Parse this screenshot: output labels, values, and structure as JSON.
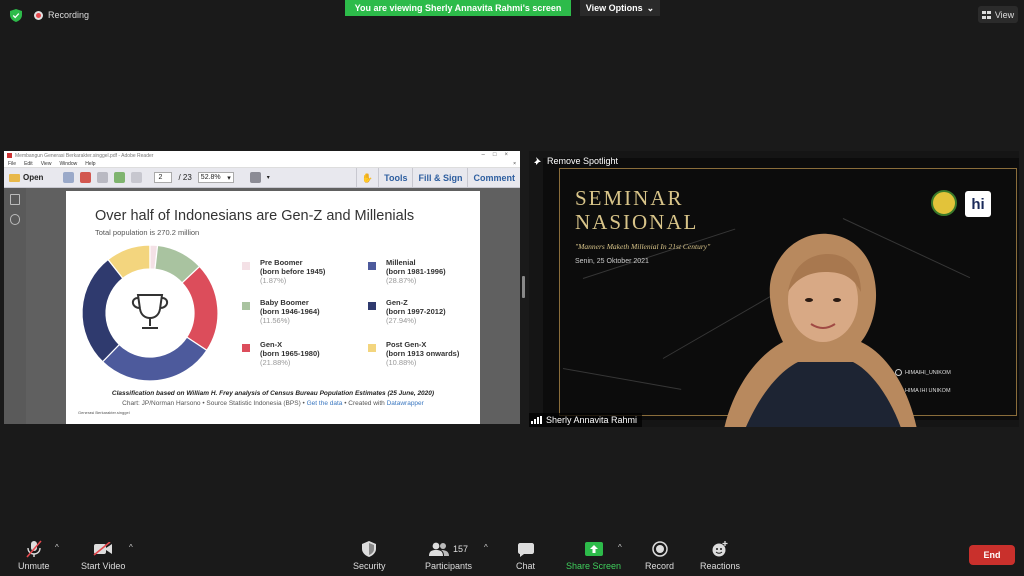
{
  "top": {
    "recording_label": "Recording",
    "banner_text": "You are viewing Sherly Annavita Rahmi's screen",
    "view_options_label": "View Options",
    "view_label": "View"
  },
  "reader": {
    "window_title": "Membangun Generasi Berkarakter.singgel.pdf - Adobe Reader",
    "menus": [
      "File",
      "Edit",
      "View",
      "Window",
      "Help"
    ],
    "open_label": "Open",
    "page_current": "2",
    "page_total": "/ 23",
    "zoom": "52.8%",
    "tools_label": "Tools",
    "fillsign_label": "Fill & Sign",
    "comment_label": "Comment"
  },
  "slide": {
    "title": "Over half of Indonesians are Gen-Z and Millenials",
    "subtitle": "Total population is 270.2 million",
    "legend": [
      {
        "name": "Pre Boomer",
        "years": "(born before 1945)",
        "pct": "(1.87%)",
        "value": 1.87,
        "color": "#f4e1e6"
      },
      {
        "name": "Baby Boomer",
        "years": "(born 1946-1964)",
        "pct": "(11.56%)",
        "value": 11.56,
        "color": "#a9c3a0"
      },
      {
        "name": "Gen-X",
        "years": "(born 1965-1980)",
        "pct": "(21.88%)",
        "value": 21.88,
        "color": "#dc4d5b"
      },
      {
        "name": "Millenial",
        "years": "(born 1981-1996)",
        "pct": "(28.87%)",
        "value": 28.87,
        "color": "#4d5a9c"
      },
      {
        "name": "Gen-Z",
        "years": "(born 1997-2012)",
        "pct": "(27.94%)",
        "value": 27.94,
        "color": "#2f3a6e"
      },
      {
        "name": "Post Gen-X",
        "years": "(born 1913 onwards)",
        "pct": "(10.88%)",
        "value": 10.88,
        "color": "#f3d57e"
      }
    ],
    "caption": "Classification based on William H. Frey analysis of Census Bureau Population Estimates (25 June, 2020)",
    "credit_prefix": "Chart: JP/Norman Harsono • Source Statistic Indonesia (BPS) •",
    "credit_link1": "Get the data",
    "credit_mid": "• Created with",
    "credit_link2": "Datawrapper",
    "tiny_note": "Generasi Berkarakter.singgel"
  },
  "chart_data": {
    "type": "pie",
    "title": "Over half of Indonesians are Gen-Z and Millenials",
    "subtitle": "Total population is 270.2 million",
    "categories": [
      "Pre Boomer",
      "Baby Boomer",
      "Gen-X",
      "Millenial",
      "Gen-Z",
      "Post Gen-X"
    ],
    "values": [
      1.87,
      11.56,
      21.88,
      28.87,
      27.94,
      10.88
    ],
    "colors": [
      "#f4e1e6",
      "#a9c3a0",
      "#dc4d5b",
      "#4d5a9c",
      "#2f3a6e",
      "#f3d57e"
    ],
    "donut": true
  },
  "video": {
    "seminar_line1": "SEMINAR",
    "seminar_line2": "NASIONAL",
    "seminar_theme": "\"Manners Maketh Millenial In 21st Century\"",
    "seminar_date": "Senin, 25 Oktober 2021",
    "logo_text": "hi",
    "social1": "HIMAIHI_UNIKOM",
    "social2": "HIMA IHI UNIKOM",
    "remove_spotlight_label": "Remove Spotlight",
    "participant_name": "Sherly Annavita Rahmi"
  },
  "toolbar": {
    "unmute": "Unmute",
    "start_video": "Start Video",
    "security": "Security",
    "participants": "Participants",
    "participants_count": "157",
    "chat": "Chat",
    "share_screen": "Share Screen",
    "record": "Record",
    "reactions": "Reactions",
    "end": "End"
  }
}
